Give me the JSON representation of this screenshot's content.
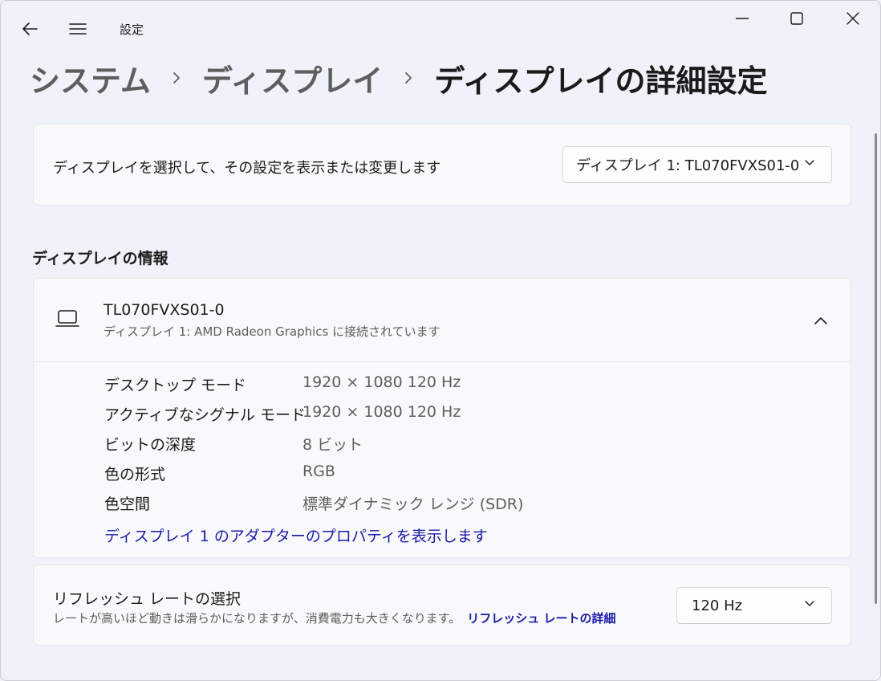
{
  "titlebar": {
    "app_title": "設定",
    "back_icon": "back-arrow-icon",
    "menu_icon": "hamburger-icon",
    "minimize_icon": "minimize-icon",
    "maximize_icon": "maximize-icon",
    "close_icon": "close-icon"
  },
  "breadcrumb": {
    "items": [
      "システム",
      "ディスプレイ",
      "ディスプレイの詳細設定"
    ]
  },
  "display_select": {
    "description": "ディスプレイを選択して、その設定を表示または変更します",
    "selected": "ディスプレイ 1: TL070FVXS01-0"
  },
  "display_info": {
    "section_title": "ディスプレイの情報",
    "name": "TL070FVXS01-0",
    "subtitle": "ディスプレイ 1: AMD Radeon Graphics に接続されています",
    "rows": [
      {
        "label": "デスクトップ モード",
        "value": "1920 × 1080 120 Hz"
      },
      {
        "label": "アクティブなシグナル モード",
        "value": "1920 × 1080 120 Hz"
      },
      {
        "label": "ビットの深度",
        "value": "8 ビット"
      },
      {
        "label": "色の形式",
        "value": "RGB"
      },
      {
        "label": "色空間",
        "value": "標準ダイナミック レンジ (SDR)"
      }
    ],
    "adapter_link": "ディスプレイ 1 のアダプターのプロパティを表示します"
  },
  "refresh_rate": {
    "title": "リフレッシュ レートの選択",
    "description": "レートが高いほど動きは滑らかになりますが、消費電力も大きくなります。",
    "link": "リフレッシュ レートの詳細",
    "selected": "120 Hz"
  },
  "colors": {
    "accent_link": "#1a1aa8",
    "background": "#eff2f8",
    "card": "#f9f9fb"
  }
}
